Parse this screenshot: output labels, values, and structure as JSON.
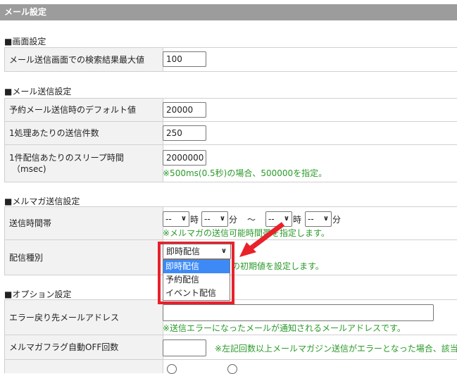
{
  "header": {
    "title": "メール設定"
  },
  "sections": {
    "screen": {
      "title": "■画面設定",
      "rows": [
        {
          "label": "メール送信画面での検索結果最大値",
          "value": "100"
        }
      ]
    },
    "mail": {
      "title": "■メール送信設定",
      "rows": [
        {
          "label": "予約メール送信時のデフォルト値",
          "value": "20000"
        },
        {
          "label": "1処理あたりの送信件数",
          "value": "250"
        },
        {
          "label": "1件配信あたりのスリープ時間",
          "label2": "（msec)",
          "value": "2000000",
          "note": "※500ms(0.5秒)の場合、500000を指定。"
        }
      ]
    },
    "magazine": {
      "title": "■メルマガ送信設定",
      "time": {
        "label": "送信時間帯",
        "start_hour": "--",
        "start_min": "--",
        "end_hour": "--",
        "end_min": "--",
        "hour_unit": "時",
        "min_unit": "分",
        "tilde": "～",
        "note": "※メルマガの送信可能時間帯を指定します。"
      },
      "type": {
        "label": "配信種別",
        "selected": "即時配信",
        "note": "の初期値を設定します。",
        "options": [
          "即時配信",
          "予約配信",
          "イベント配信"
        ]
      }
    },
    "option": {
      "title": "■オプション設定",
      "rows": [
        {
          "label": "エラー戻り先メールアドレス",
          "value": "",
          "note": "※送信エラーになったメールが通知されるメールアドレスです。"
        },
        {
          "label": "メルマガフラグ自動OFF回数",
          "value": "",
          "note": "※左記回数以上メールマガジン送信がエラーとなった場合、該当"
        }
      ]
    }
  },
  "colors": {
    "highlight": "#e8212b",
    "note": "#2a9a2a",
    "selected_option": "#3d8af7"
  }
}
